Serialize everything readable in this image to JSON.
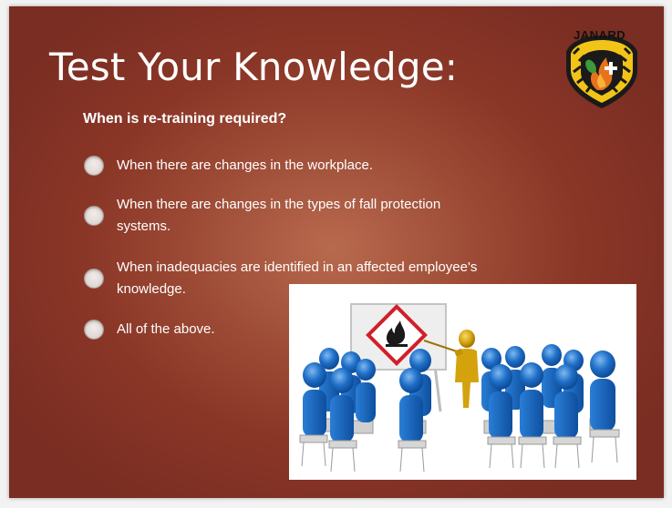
{
  "slide": {
    "title": "Test Your Knowledge:",
    "question": "When is re-training required?",
    "options": [
      "When there are changes in the workplace.",
      "When there are changes in the types of fall protection systems.",
      "When inadequacies are identified in an affected employee's knowledge.",
      "All of the above."
    ]
  },
  "logo": {
    "text": "JANARD",
    "icon": "janard-shield-logo"
  },
  "picture": {
    "icon": "flammable-hazard-training-illustration"
  },
  "colors": {
    "slide_background": "#8a3627",
    "slide_highlight": "#b86a4e",
    "text": "#ffffff",
    "hazard_red": "#d0202a",
    "figure_blue": "#1f6fc8",
    "figure_gold": "#d4a20c"
  }
}
